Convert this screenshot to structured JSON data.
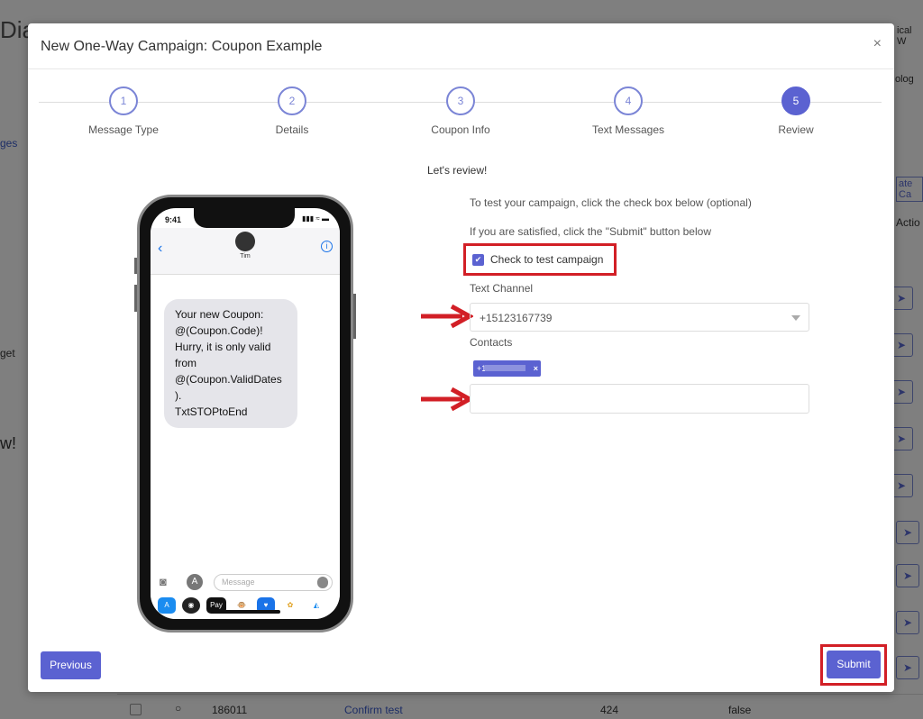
{
  "background": {
    "app_title_fragment": "Dia",
    "side_fragments": [
      "ges",
      "get",
      "w!"
    ],
    "header_fragments": [
      "olog",
      "ate Ca",
      "Actio",
      "ical W"
    ],
    "bottom_row": {
      "id": "186011",
      "name": "Confirm test",
      "count": "424",
      "flag": "false"
    }
  },
  "modal": {
    "title": "New One-Way Campaign: Coupon Example",
    "close_label": "×",
    "steps": [
      {
        "number": "1",
        "label": "Message Type"
      },
      {
        "number": "2",
        "label": "Details"
      },
      {
        "number": "3",
        "label": "Coupon Info"
      },
      {
        "number": "4",
        "label": "Text Messages"
      },
      {
        "number": "5",
        "label": "Review"
      }
    ],
    "active_step": 5,
    "phone": {
      "time": "9:41",
      "status_icons": "▮▮▮ ≈ ▬",
      "contact_name": "Tim",
      "message": "Your new Coupon:\n@(Coupon.Code)!\nHurry, it is only valid from\n@(Coupon.ValidDates\n).\nTxtSTOPtoEnd",
      "message_placeholder": "Message",
      "app_icons": [
        "A",
        "◉",
        "Pay",
        "🐵",
        "♥",
        "✿",
        "◭"
      ]
    },
    "review": {
      "heading": "Let's review!",
      "help_test": "To test your campaign, click the check box below (optional)",
      "help_submit": "If you are satisfied, click the \"Submit\" button below",
      "test_checkbox_label": "Check to test campaign",
      "test_checkbox_checked": true,
      "text_channel_label": "Text Channel",
      "text_channel_value": "+15123167739",
      "contacts_label": "Contacts",
      "contact_chip_prefix": "+1",
      "contact_chip_remove": "×",
      "contacts_input_value": ""
    },
    "buttons": {
      "previous": "Previous",
      "submit": "Submit"
    },
    "colors": {
      "accent": "#5b62d1",
      "highlight": "#d21f26"
    }
  }
}
